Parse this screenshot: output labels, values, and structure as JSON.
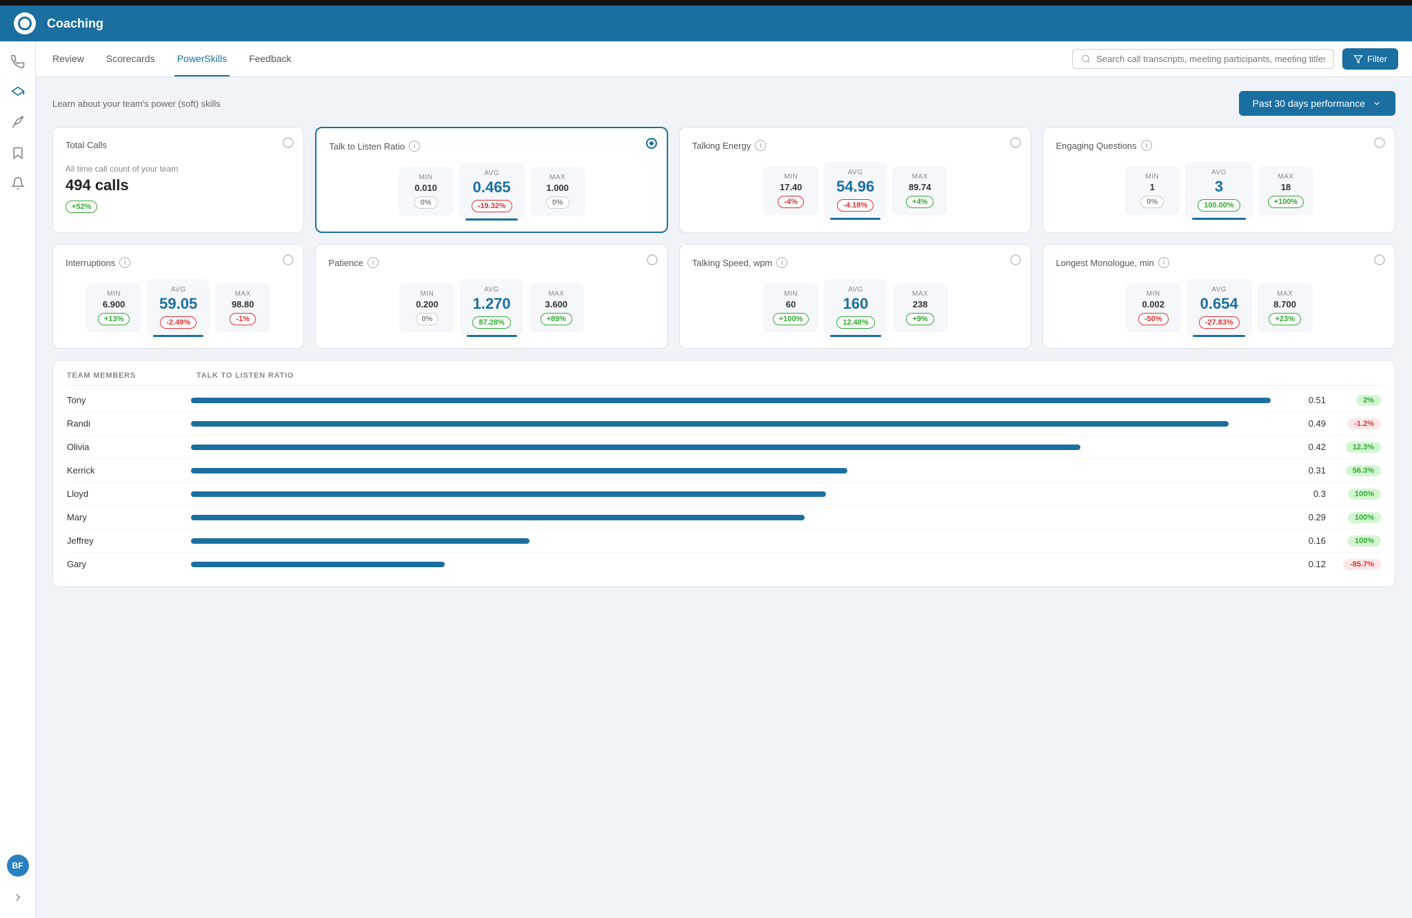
{
  "app": {
    "title": "Coaching"
  },
  "topbar": {
    "title": "Coaching"
  },
  "nav": {
    "tabs": [
      {
        "label": "Review",
        "active": false
      },
      {
        "label": "Scorecards",
        "active": false
      },
      {
        "label": "PowerSkills",
        "active": true
      },
      {
        "label": "Feedback",
        "active": false
      }
    ],
    "search_placeholder": "Search call transcripts, meeting participants, meeting titles...",
    "filter_label": "Filter"
  },
  "content": {
    "subtitle": "Learn about your team's power (soft) skills",
    "period_label": "Past 30 days performance"
  },
  "cards_row1": [
    {
      "id": "total-calls",
      "title": "Total Calls",
      "selected": false,
      "type": "total",
      "all_time_label": "All time call count of your team",
      "calls_value": "494 calls",
      "change": "+52%",
      "change_type": "green"
    },
    {
      "id": "talk-to-listen",
      "title": "Talk to Listen Ratio",
      "selected": true,
      "min": "0.010",
      "avg": "0.465",
      "max": "1.000",
      "min_change": "0%",
      "min_change_type": "neutral",
      "avg_change": "-19.32%",
      "avg_change_type": "red",
      "max_change": "0%",
      "max_change_type": "neutral"
    },
    {
      "id": "talking-energy",
      "title": "Talking Energy",
      "selected": false,
      "min": "17.40",
      "avg": "54.96",
      "max": "89.74",
      "min_change": "-4%",
      "min_change_type": "red",
      "avg_change": "-4.18%",
      "avg_change_type": "red",
      "max_change": "+4%",
      "max_change_type": "green"
    },
    {
      "id": "engaging-questions",
      "title": "Engaging Questions",
      "selected": false,
      "min": "1",
      "avg": "3",
      "max": "18",
      "min_change": "0%",
      "min_change_type": "neutral",
      "avg_change": "100.00%",
      "avg_change_type": "green",
      "max_change": "+100%",
      "max_change_type": "green"
    }
  ],
  "cards_row2": [
    {
      "id": "interruptions",
      "title": "Interruptions",
      "selected": false,
      "min": "6.900",
      "avg": "59.05",
      "max": "98.80",
      "min_change": "+13%",
      "min_change_type": "green",
      "avg_change": "-2.49%",
      "avg_change_type": "red",
      "max_change": "-1%",
      "max_change_type": "red"
    },
    {
      "id": "patience",
      "title": "Patience",
      "selected": false,
      "min": "0.200",
      "avg": "1.270",
      "max": "3.600",
      "min_change": "0%",
      "min_change_type": "neutral",
      "avg_change": "87.28%",
      "avg_change_type": "green",
      "max_change": "+89%",
      "max_change_type": "green"
    },
    {
      "id": "talking-speed",
      "title": "Talking Speed, wpm",
      "selected": false,
      "min": "60",
      "avg": "160",
      "max": "238",
      "min_change": "+100%",
      "min_change_type": "green",
      "avg_change": "12.48%",
      "avg_change_type": "green",
      "max_change": "+9%",
      "max_change_type": "green"
    },
    {
      "id": "longest-monologue",
      "title": "Longest Monologue, min",
      "selected": false,
      "min": "0.002",
      "avg": "0.654",
      "max": "8.700",
      "min_change": "-50%",
      "min_change_type": "red",
      "avg_change": "-27.83%",
      "avg_change_type": "red",
      "max_change": "+23%",
      "max_change_type": "green"
    }
  ],
  "team_table": {
    "col_members": "TEAM MEMBERS",
    "col_metric": "TALK TO LISTEN RATIO",
    "rows": [
      {
        "name": "Tony",
        "value": 0.51,
        "bar_pct": 100,
        "change": "2%",
        "change_type": "green"
      },
      {
        "name": "Randi",
        "value": 0.49,
        "bar_pct": 96,
        "change": "-1.2%",
        "change_type": "red"
      },
      {
        "name": "Olivia",
        "value": 0.42,
        "bar_pct": 82,
        "change": "12.3%",
        "change_type": "green"
      },
      {
        "name": "Kerrick",
        "value": 0.31,
        "bar_pct": 61,
        "change": "56.3%",
        "change_type": "green"
      },
      {
        "name": "Lloyd",
        "value": 0.3,
        "bar_pct": 59,
        "change": "100%",
        "change_type": "green"
      },
      {
        "name": "Mary",
        "value": 0.29,
        "bar_pct": 57,
        "change": "100%",
        "change_type": "green"
      },
      {
        "name": "Jeffrey",
        "value": 0.16,
        "bar_pct": 31,
        "change": "100%",
        "change_type": "green"
      },
      {
        "name": "Gary",
        "value": 0.12,
        "bar_pct": 24,
        "change": "-85.7%",
        "change_type": "red"
      }
    ]
  },
  "sidebar": {
    "icons": [
      {
        "name": "phone-icon",
        "symbol": "📞"
      },
      {
        "name": "graduation-icon",
        "symbol": "🎓"
      },
      {
        "name": "leaf-icon",
        "symbol": "🌿"
      },
      {
        "name": "bookmark-icon",
        "symbol": "🔖"
      },
      {
        "name": "bell-icon",
        "symbol": "🔔"
      }
    ],
    "avatar_initials": "BF"
  }
}
